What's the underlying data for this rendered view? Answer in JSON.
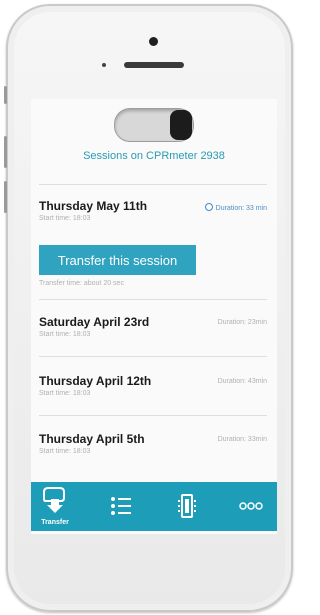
{
  "header": {
    "title": "Sessions on CPRmeter 2938",
    "toggle_state": "on"
  },
  "sessions": [
    {
      "date": "Thursday May 11th",
      "start": "Start time: 18:03",
      "duration": "Duration: 33 min",
      "selected": true
    },
    {
      "date": "Saturday April 23rd",
      "start": "Start time: 18:03",
      "duration": "Duration: 23min"
    },
    {
      "date": "Thursday April 12th",
      "start": "Start time: 18:03",
      "duration": "Duration: 43min"
    },
    {
      "date": "Thursday April 5th",
      "start": "Start time: 18:03",
      "duration": "Duration: 33min"
    }
  ],
  "transfer": {
    "button_label": "Transfer this session",
    "time_text": "Transfer time: about 20 sec"
  },
  "tabbar": {
    "items": [
      {
        "label": "Transfer",
        "icon": "transfer-icon"
      },
      {
        "label": "",
        "icon": "list-icon"
      },
      {
        "label": "",
        "icon": "device-icon"
      },
      {
        "label": "",
        "icon": "more-icon"
      }
    ]
  },
  "colors": {
    "accent": "#1e9db8",
    "button": "#2fa3bf",
    "title": "#2a9bb3",
    "duration_selected": "#4a90c8"
  }
}
